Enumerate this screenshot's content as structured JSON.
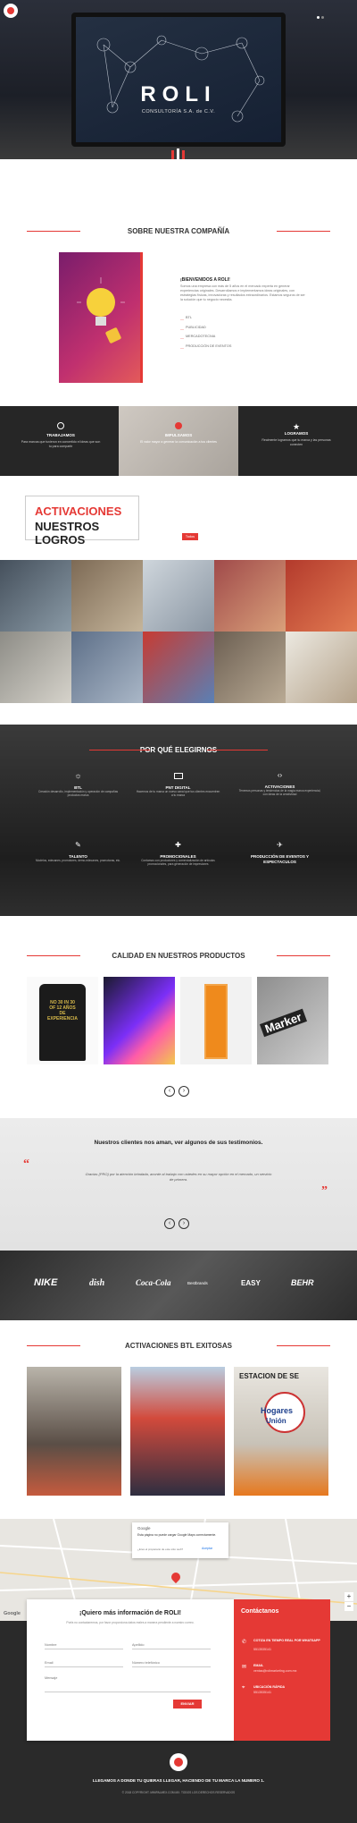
{
  "hero": {
    "brand": "ROLI",
    "subtitle": "CONSULTORÍA S.A. de C.V.",
    "logo_text": "ROLI"
  },
  "about": {
    "title": "SOBRE NUESTRA COMPAÑÍA",
    "welcome": "¡BIENVENIDOS A ROLI!",
    "text": "Somos una empresa con más de 5 años en el mercado experta en generar experiencias originales. Desarrollamos e implementamos ideas originales, con estrategias físicas, innovadoras y resultados extraordinarios. Estamos seguros de ser la solución que tu negocio necesita.",
    "list": [
      "BTL",
      "PUBLICIDAD",
      "MERCADOTECNIA",
      "PRODUCCIÓN DE EVENTOS"
    ]
  },
  "features": [
    {
      "title": "TRABAJAMOS",
      "text": "Para marcas que tuvieron en convertido el ideas que son tu para compartir"
    },
    {
      "title": "IMPULSAMOS",
      "text": "El valor mayor a generar la comunicación a tus clientes"
    },
    {
      "title": "LOGRAMOS",
      "text": "Realmente logramos que tu marca y las personas conecten"
    }
  ],
  "achievements": {
    "title_1": "ACTIVACIONES",
    "title_2": "NUESTROS LOGROS",
    "button": "Todos"
  },
  "why": {
    "title": "POR QUÉ ELEGIRNOS",
    "items": [
      {
        "title": "BTL",
        "text": "Creación desarrollo, implementación y operación de campañas productos marca"
      },
      {
        "title": "PNT DIGITAL",
        "text": "Hacemos de tu marca un nuevo canal que tus clientes encuentren a tu marca"
      },
      {
        "title": "ACTIVACIONES",
        "text": "Tenemos personas y tendencias de la magia marca experiencial, con ideas de la creatividad"
      },
      {
        "title": "TALENTO",
        "text": "Modelos, edecanes, promotores, demo-edecanes, promotoras, etc."
      },
      {
        "title": "PROMOCIONALES",
        "text": "Contamos con productores y comercialización de artículos promocionales, para generación de impresiones"
      },
      {
        "title": "PRODUCCIÓN DE EVENTOS Y ESPECTACULOS",
        "text": ""
      }
    ]
  },
  "quality": {
    "title": "CALIDAD EN NUESTROS PRODUCTOS",
    "shirt_text": "NO 30 IN 30 OF 12 AÑOS DE EXPERIENCIA",
    "marker_text": "Marker"
  },
  "testimonials": {
    "title": "Nuestros clientes nos aman, ver algunos de sus testimonios.",
    "quote": "Gracias {PRO} por la atención brindada, acorde al trabajo con ustedes en su mayor opción en el mercado, un servicio de primera."
  },
  "clients": [
    "NIKE",
    "dish",
    "Coca-Cola",
    "Bestbrands",
    "EASY",
    "BEHR"
  ],
  "success": {
    "title": "ACTIVACIONES BTL EXITOSAS",
    "photo3_sign_1": "ESTACION DE SE",
    "photo3_sign_2": "Hogares",
    "photo3_sign_3": "Unión"
  },
  "map": {
    "dialog_title": "Google",
    "dialog_text": "Esta página no puede cargar Google Maps correctamente.",
    "dialog_question": "¿Eres el propietario de este sitio web?",
    "dialog_button": "Aceptar",
    "google": "Google"
  },
  "contact": {
    "title": "¡Quiero más información de ROLI!",
    "subtitle": "Porfa no contactaremos, por favor proporciona datos reales a manera pendiente a nuestro correo.",
    "name_ph": "Nombre",
    "last_ph": "Apellido",
    "email_ph": "Email",
    "phone_ph": "Número telefónico",
    "message_ph": "Mensaje",
    "send": "ENVIAR",
    "panel_title": "Contáctanos",
    "items": [
      {
        "title": "COTIZA EN TIEMPO REAL POR WHATSAPP",
        "value": "5513535141"
      },
      {
        "title": "EMAIL",
        "value": "ventas@rolimarketing.com.mx"
      },
      {
        "title": "UBICACIÓN RÁPIDA",
        "value": "5513535141"
      }
    ]
  },
  "footer": {
    "tagline": "LLEGAMOS A DONDE TU QUIERAS LLEGAR, HACIENDO DE TU MARCA LA NUMERO 1.",
    "copyright": "© 2018 COPYRIGHT. MIMPALMEX.COM.MX. TODOS LOS DERECHOS RESERVADOS"
  },
  "colors": {
    "accent": "#e53935",
    "dark": "#262626"
  }
}
